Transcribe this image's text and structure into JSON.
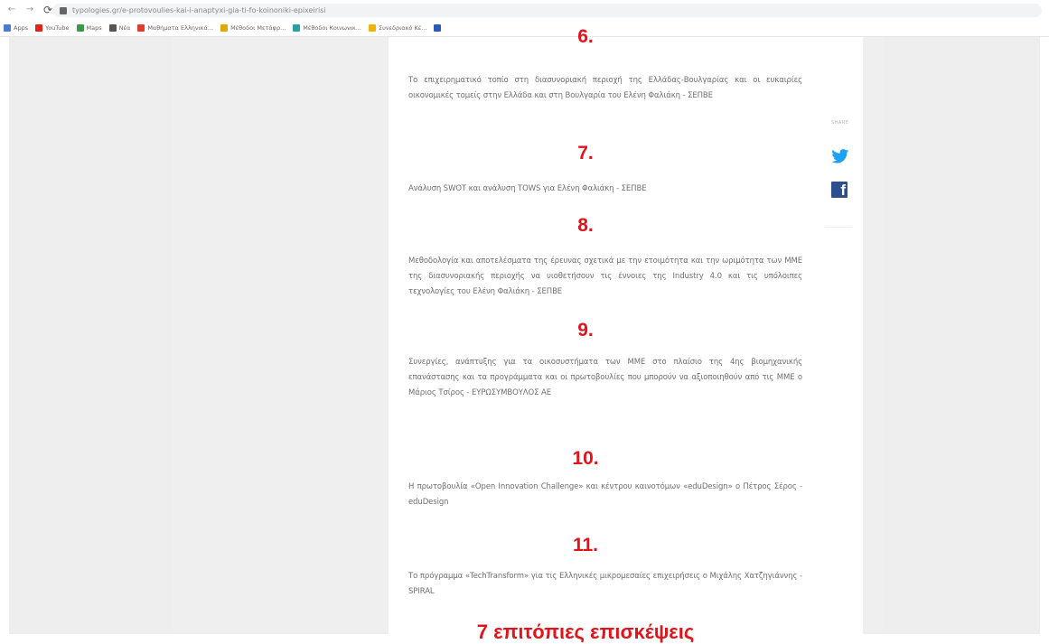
{
  "browser": {
    "url": "typologies.gr/e-protovoulies-kai-i-anaptyxi-gia-ti-fo-koinoniki-epixeirisi",
    "bookmarks": [
      {
        "label": "Apps",
        "color": "#4a7bd0"
      },
      {
        "label": "YouTube",
        "color": "#e62117"
      },
      {
        "label": "Maps",
        "color": "#3a9a4a"
      },
      {
        "label": "Νέα",
        "color": "#555555"
      },
      {
        "label": "Μαθήματα Ελληνικά...",
        "color": "#e23b2e"
      },
      {
        "label": "Μέθοδοι Μετάφρ...",
        "color": "#e0a800"
      },
      {
        "label": "Μέθοδοι Κοινωνικ...",
        "color": "#27a0a0"
      },
      {
        "label": "Συνεδριακό Κέ...",
        "color": "#f0b400"
      },
      {
        "label": "",
        "color": "#2a5ab8"
      }
    ]
  },
  "article": {
    "sections": [
      {
        "number": "6.",
        "text": "Το επιχειρηματικό τοπίο στη διασυνοριακή περιοχή της Ελλάδας-Βουλγαρίας και οι ευκαιρίες οικονομικές τομείς στην Ελλάδα και στη Βουλγαρία του Ελένη Φαλιάκη - ΣΕΠΒΕ"
      },
      {
        "number": "7.",
        "text": "Ανάλυση SWOT και ανάλυση TOWS για Ελένη Φαλιάκη - ΣΕΠΒΕ"
      },
      {
        "number": "8.",
        "text": "Μεθοδολογία και αποτελέσματα της έρευνας σχετικά με την ετοιμότητα και την ωριμότητα των ΜΜΕ της διασυνοριακής περιοχής να υιοθετήσουν τις έννοιες της Industry 4.0 και τις υπόλοιπες τεχνολογίες του Ελένη Φαλιάκη - ΣΕΠΒΕ"
      },
      {
        "number": "9.",
        "text": "Συνεργίες, ανάπτυξης για τα οικοσυστήματα των ΜΜΕ στο πλαίσιο της 4ης βιομηχανικής επανάστασης και τα προγράμματα και οι πρωτοβουλίες που μπορούν να αξιοποιηθούν από τις ΜΜΕ ο Μάριος Τσίρος - ΕΥΡΩΣΥΜΒΟΥΛΟΣ ΑΕ"
      },
      {
        "number": "10.",
        "text": "Η πρωτοβουλία «Open Innovation Challenge» και κέντρου καινοτόμων «eduDesign» ο Πέτρος Σέρος - eduDesign"
      },
      {
        "number": "11.",
        "text": "Το πρόγραμμα «TechTransform» για τις Ελληνικές μικρομεσαίες επιχειρήσεις ο Μιχάλης Χατζηγιάννης - SPIRAL"
      }
    ],
    "next_heading": "7 επιτόπιες επισκέψεις"
  },
  "share": {
    "label": "SHARE",
    "twitter_color": "#1da1f2",
    "facebook_color": "#2d4f8f",
    "facebook_glyph": "f"
  }
}
